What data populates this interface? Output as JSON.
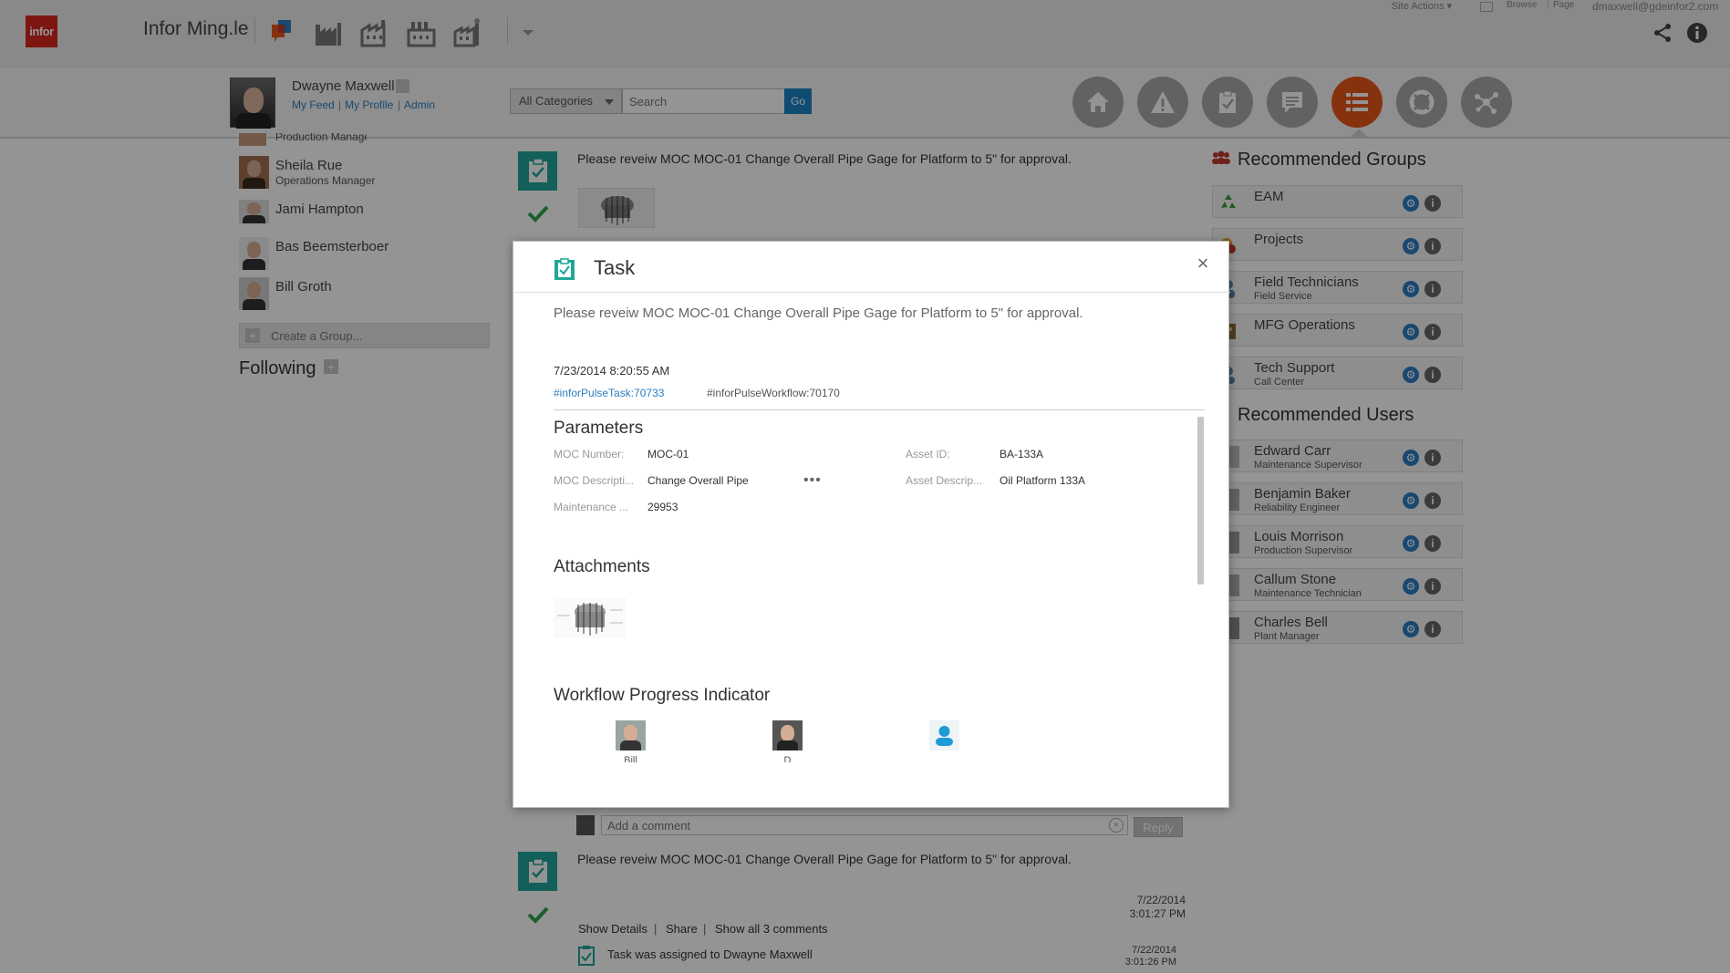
{
  "topbar": {
    "logo_text": "infor",
    "app_name": "Infor Ming.le",
    "icons": [
      "ming-le-icon",
      "factory-icon-1",
      "factory-icon-2",
      "factory-icon-3",
      "factory-icon-4"
    ],
    "site_actions": "Site Actions",
    "browse": "Browse",
    "page": "Page",
    "user_email": "dmaxwell@gdeinfor2.com"
  },
  "profile": {
    "name": "Dwayne Maxwell",
    "links": [
      "My Feed",
      "My Profile",
      "Admin"
    ]
  },
  "search": {
    "category": "All Categories",
    "placeholder": "Search",
    "go_label": "Go"
  },
  "nav_icons": [
    "home-icon",
    "alert-icon",
    "tasks-icon",
    "messages-icon",
    "feed-list-icon",
    "help-ring-icon",
    "network-icon"
  ],
  "nav_active": "feed-list-icon",
  "left_people": [
    {
      "name": "",
      "role": "Production Manager"
    },
    {
      "name": "Sheila Rue",
      "role": "Operations Manager"
    },
    {
      "name": "Jami Hampton",
      "role": ""
    },
    {
      "name": "Bas Beemsterboer",
      "role": ""
    },
    {
      "name": "Bill Groth",
      "role": ""
    }
  ],
  "create_group_label": "Create a Group...",
  "following_label": "Following",
  "feed": {
    "item1_text": "Please reveiw MOC MOC-01 Change Overall Pipe Gage for Platform to 5\" for approval.",
    "comment_placeholder": "Add a comment",
    "reply_label": "Reply",
    "item2_text": "Please reveiw MOC MOC-01 Change Overall Pipe Gage for Platform to 5\" for approval.",
    "item2_date": "7/22/2014",
    "item2_time": "3:01:27 PM",
    "actions": [
      "Show Details",
      "Share",
      "Show all 3 comments"
    ],
    "assigned_text": "Task was assigned to Dwayne Maxwell",
    "assigned_date": "7/22/2014",
    "assigned_time": "3:01:26 PM"
  },
  "recommended_groups": {
    "title": "Recommended Groups",
    "items": [
      {
        "name": "EAM",
        "sub": ""
      },
      {
        "name": "Projects",
        "sub": ""
      },
      {
        "name": "Field Technicians",
        "sub": "Field Service"
      },
      {
        "name": "MFG Operations",
        "sub": ""
      },
      {
        "name": "Tech Support",
        "sub": "Call Center"
      }
    ]
  },
  "recommended_users": {
    "title": "Recommended Users",
    "items": [
      {
        "name": "Edward Carr",
        "sub": "Maintenance Supervisor"
      },
      {
        "name": "Benjamin Baker",
        "sub": "Reliability Engineer"
      },
      {
        "name": "Louis Morrison",
        "sub": "Production Supervisor"
      },
      {
        "name": "Callum Stone",
        "sub": "Maintenance Technician"
      },
      {
        "name": "Charles Bell",
        "sub": "Plant Manager"
      }
    ]
  },
  "modal": {
    "title": "Task",
    "description": "Please reveiw MOC MOC-01 Change Overall Pipe Gage for Platform to 5\" for approval.",
    "datetime": "7/23/2014 8:20:55 AM",
    "tag1": "#inforPulseTask:70733",
    "tag2": "#inforPulseWorkflow:70170",
    "parameters_title": "Parameters",
    "params": {
      "moc_number_label": "MOC Number:",
      "moc_number_value": "MOC-01",
      "moc_desc_label": "MOC Descripti...",
      "moc_desc_value": "Change Overall Pipe",
      "maintenance_label": "Maintenance ...",
      "maintenance_value": "29953",
      "asset_id_label": "Asset ID:",
      "asset_id_value": "BA-133A",
      "asset_desc_label": "Asset Descrip...",
      "asset_desc_value": "Oil Platform 133A"
    },
    "attachments_title": "Attachments",
    "workflow_title": "Workflow Progress Indicator",
    "workflow_labels": [
      "Bill",
      "D",
      ""
    ]
  },
  "colors": {
    "brand_red": "#d8271e",
    "task_teal": "#20a69a",
    "active_orange": "#e8561a",
    "link_blue": "#2a7fc2"
  }
}
